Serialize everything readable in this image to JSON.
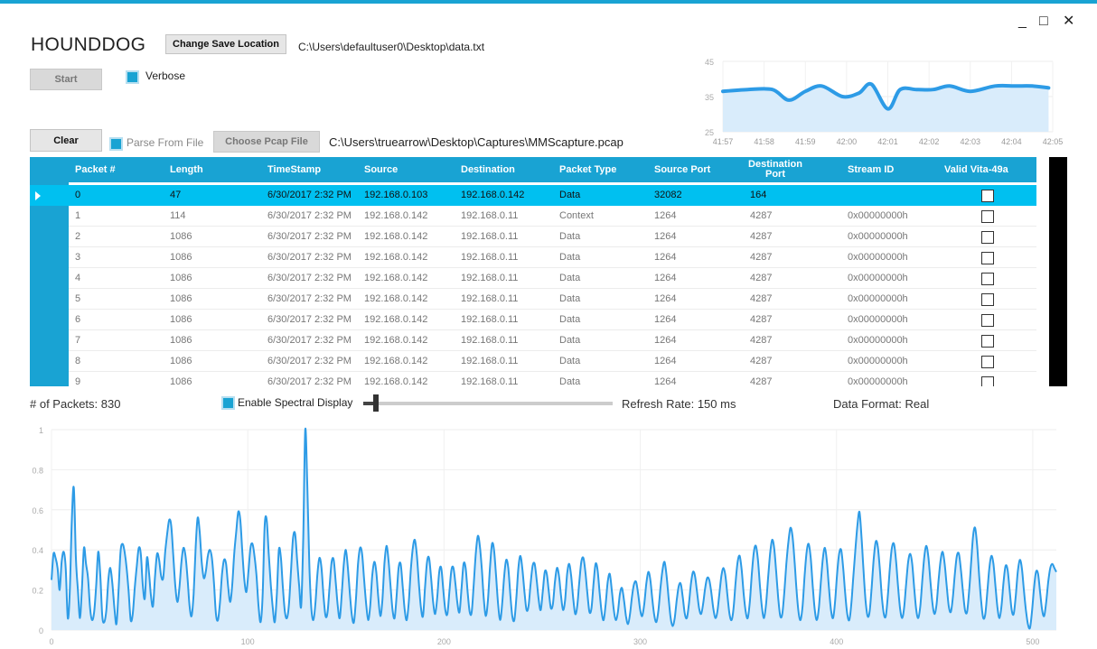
{
  "window": {
    "minimize_glyph": "_",
    "maximize_glyph": "□",
    "close_glyph": "✕"
  },
  "app": {
    "title": "HOUNDDOG"
  },
  "toolbar": {
    "change_save_location_label": "Change Save Location",
    "save_path": "C:\\Users\\defaultuser0\\Desktop\\data.txt",
    "start_label": "Start",
    "verbose_label": "Verbose",
    "clear_label": "Clear",
    "parse_from_file_label": "Parse From File",
    "choose_pcap_label": "Choose Pcap File",
    "pcap_path": "C:\\Users\\truearrow\\Desktop\\Captures\\MMScapture.pcap"
  },
  "table": {
    "columns": [
      "Packet #",
      "Length",
      "TimeStamp",
      "Source",
      "Destination",
      "Packet Type",
      "Source Port",
      "Destination Port",
      "Stream ID",
      "Valid Vita-49a"
    ],
    "rows": [
      [
        "0",
        "47",
        "6/30/2017 2:32 PM",
        "192.168.0.103",
        "192.168.0.142",
        "Data",
        "32082",
        "164",
        ""
      ],
      [
        "1",
        "114",
        "6/30/2017 2:32 PM",
        "192.168.0.142",
        "192.168.0.11",
        "Context",
        "1264",
        "4287",
        "0x00000000h"
      ],
      [
        "2",
        "1086",
        "6/30/2017 2:32 PM",
        "192.168.0.142",
        "192.168.0.11",
        "Data",
        "1264",
        "4287",
        "0x00000000h"
      ],
      [
        "3",
        "1086",
        "6/30/2017 2:32 PM",
        "192.168.0.142",
        "192.168.0.11",
        "Data",
        "1264",
        "4287",
        "0x00000000h"
      ],
      [
        "4",
        "1086",
        "6/30/2017 2:32 PM",
        "192.168.0.142",
        "192.168.0.11",
        "Data",
        "1264",
        "4287",
        "0x00000000h"
      ],
      [
        "5",
        "1086",
        "6/30/2017 2:32 PM",
        "192.168.0.142",
        "192.168.0.11",
        "Data",
        "1264",
        "4287",
        "0x00000000h"
      ],
      [
        "6",
        "1086",
        "6/30/2017 2:32 PM",
        "192.168.0.142",
        "192.168.0.11",
        "Data",
        "1264",
        "4287",
        "0x00000000h"
      ],
      [
        "7",
        "1086",
        "6/30/2017 2:32 PM",
        "192.168.0.142",
        "192.168.0.11",
        "Data",
        "1264",
        "4287",
        "0x00000000h"
      ],
      [
        "8",
        "1086",
        "6/30/2017 2:32 PM",
        "192.168.0.142",
        "192.168.0.11",
        "Data",
        "1264",
        "4287",
        "0x00000000h"
      ],
      [
        "9",
        "1086",
        "6/30/2017 2:32 PM",
        "192.168.0.142",
        "192.168.0.11",
        "Data",
        "1264",
        "4287",
        "0x00000000h"
      ]
    ],
    "selected_row": 0
  },
  "status": {
    "packet_count_label": "# of Packets: 830",
    "spectral_label": "Enable Spectral Display",
    "refresh_label": "Refresh Rate: 150 ms",
    "format_label": "Data Format: Real",
    "slider_value_fraction": 0.05
  },
  "colors": {
    "accent": "#19a3d3",
    "selected_row": "#00c0f0",
    "line": "#2d9be6",
    "area": "#d9ecfb"
  },
  "chart_data": [
    {
      "type": "area",
      "x_labels": [
        "41:57",
        "41:58",
        "41:59",
        "42:00",
        "42:01",
        "42:02",
        "42:03",
        "42:04",
        "42:05"
      ],
      "x": [
        0,
        0.6,
        1.2,
        1.6,
        2.0,
        2.4,
        2.9,
        3.3,
        3.6,
        4.0,
        4.3,
        4.7,
        5.1,
        5.5,
        6.0,
        6.6,
        7.1,
        7.5,
        7.9
      ],
      "values": [
        36.5,
        37,
        37,
        34,
        36.5,
        38,
        35,
        36,
        38.5,
        31.5,
        37,
        37,
        37,
        38,
        36.5,
        38,
        38,
        38,
        37.5
      ],
      "ylim": [
        25,
        45
      ],
      "y_ticks": [
        "25",
        "35",
        "45"
      ],
      "grid": true
    },
    {
      "type": "area",
      "xlim": [
        0,
        512
      ],
      "ylim": [
        0,
        1
      ],
      "x_ticks": [
        "0",
        "100",
        "200",
        "300",
        "400",
        "500"
      ],
      "y_ticks": [
        "0",
        "0.2",
        "0.4",
        "0.6",
        "0.8",
        "1"
      ],
      "grid": true,
      "values": [
        0.25,
        0.38,
        0.36,
        0.31,
        0.2,
        0.34,
        0.39,
        0.31,
        0.06,
        0.19,
        0.55,
        0.71,
        0.36,
        0.2,
        0.06,
        0.21,
        0.41,
        0.33,
        0.26,
        0.11,
        0.05,
        0.09,
        0.22,
        0.39,
        0.28,
        0.07,
        0.04,
        0.1,
        0.25,
        0.31,
        0.23,
        0.11,
        0.03,
        0.19,
        0.39,
        0.43,
        0.39,
        0.31,
        0.19,
        0.05,
        0.08,
        0.21,
        0.32,
        0.41,
        0.38,
        0.22,
        0.16,
        0.36,
        0.29,
        0.17,
        0.12,
        0.27,
        0.38,
        0.35,
        0.27,
        0.26,
        0.39,
        0.48,
        0.55,
        0.52,
        0.37,
        0.22,
        0.14,
        0.21,
        0.34,
        0.41,
        0.37,
        0.26,
        0.12,
        0.07,
        0.18,
        0.41,
        0.56,
        0.49,
        0.34,
        0.26,
        0.29,
        0.37,
        0.4,
        0.36,
        0.24,
        0.08,
        0.05,
        0.14,
        0.28,
        0.35,
        0.33,
        0.22,
        0.14,
        0.22,
        0.38,
        0.49,
        0.59,
        0.55,
        0.39,
        0.25,
        0.19,
        0.29,
        0.41,
        0.43,
        0.37,
        0.27,
        0.12,
        0.04,
        0.17,
        0.52,
        0.55,
        0.38,
        0.23,
        0.11,
        0.04,
        0.18,
        0.4,
        0.36,
        0.21,
        0.09,
        0.06,
        0.13,
        0.3,
        0.46,
        0.48,
        0.35,
        0.22,
        0.12,
        0.46,
        1.0,
        0.72,
        0.33,
        0.11,
        0.05,
        0.13,
        0.28,
        0.36,
        0.31,
        0.17,
        0.07,
        0.09,
        0.22,
        0.34,
        0.35,
        0.24,
        0.12,
        0.06,
        0.18,
        0.33,
        0.4,
        0.31,
        0.18,
        0.07,
        0.04,
        0.16,
        0.33,
        0.41,
        0.38,
        0.25,
        0.13,
        0.05,
        0.12,
        0.27,
        0.34,
        0.29,
        0.16,
        0.07,
        0.15,
        0.33,
        0.42,
        0.35,
        0.22,
        0.1,
        0.06,
        0.17,
        0.31,
        0.33,
        0.22,
        0.1,
        0.05,
        0.14,
        0.3,
        0.41,
        0.45,
        0.37,
        0.23,
        0.11,
        0.07,
        0.21,
        0.34,
        0.36,
        0.26,
        0.14,
        0.08,
        0.16,
        0.29,
        0.31,
        0.2,
        0.1,
        0.08,
        0.19,
        0.3,
        0.31,
        0.23,
        0.13,
        0.09,
        0.21,
        0.33,
        0.31,
        0.19,
        0.09,
        0.09,
        0.23,
        0.38,
        0.47,
        0.42,
        0.3,
        0.15,
        0.07,
        0.15,
        0.31,
        0.43,
        0.4,
        0.27,
        0.13,
        0.05,
        0.13,
        0.27,
        0.35,
        0.31,
        0.18,
        0.07,
        0.05,
        0.16,
        0.31,
        0.37,
        0.3,
        0.19,
        0.1,
        0.12,
        0.23,
        0.32,
        0.33,
        0.25,
        0.15,
        0.1,
        0.19,
        0.29,
        0.28,
        0.19,
        0.11,
        0.13,
        0.24,
        0.31,
        0.27,
        0.17,
        0.1,
        0.15,
        0.28,
        0.33,
        0.27,
        0.16,
        0.08,
        0.12,
        0.24,
        0.34,
        0.36,
        0.29,
        0.18,
        0.09,
        0.11,
        0.23,
        0.33,
        0.3,
        0.19,
        0.09,
        0.05,
        0.13,
        0.24,
        0.28,
        0.2,
        0.1,
        0.05,
        0.09,
        0.18,
        0.21,
        0.15,
        0.07,
        0.03,
        0.08,
        0.17,
        0.23,
        0.24,
        0.18,
        0.1,
        0.07,
        0.13,
        0.23,
        0.29,
        0.25,
        0.15,
        0.07,
        0.04,
        0.1,
        0.21,
        0.3,
        0.34,
        0.27,
        0.16,
        0.06,
        0.02,
        0.06,
        0.15,
        0.22,
        0.23,
        0.16,
        0.08,
        0.06,
        0.13,
        0.23,
        0.29,
        0.27,
        0.19,
        0.11,
        0.08,
        0.13,
        0.21,
        0.26,
        0.25,
        0.19,
        0.11,
        0.06,
        0.09,
        0.18,
        0.27,
        0.31,
        0.27,
        0.17,
        0.08,
        0.05,
        0.11,
        0.24,
        0.34,
        0.37,
        0.3,
        0.18,
        0.09,
        0.06,
        0.14,
        0.28,
        0.39,
        0.42,
        0.35,
        0.22,
        0.11,
        0.06,
        0.13,
        0.26,
        0.38,
        0.45,
        0.41,
        0.29,
        0.16,
        0.07,
        0.08,
        0.19,
        0.33,
        0.44,
        0.51,
        0.47,
        0.35,
        0.2,
        0.09,
        0.05,
        0.12,
        0.27,
        0.39,
        0.43,
        0.36,
        0.22,
        0.1,
        0.05,
        0.11,
        0.24,
        0.36,
        0.41,
        0.34,
        0.21,
        0.1,
        0.06,
        0.14,
        0.28,
        0.38,
        0.4,
        0.31,
        0.18,
        0.08,
        0.05,
        0.13,
        0.27,
        0.4,
        0.52,
        0.59,
        0.47,
        0.3,
        0.15,
        0.07,
        0.09,
        0.21,
        0.35,
        0.44,
        0.42,
        0.31,
        0.17,
        0.08,
        0.07,
        0.17,
        0.31,
        0.41,
        0.43,
        0.35,
        0.22,
        0.11,
        0.06,
        0.11,
        0.23,
        0.34,
        0.38,
        0.33,
        0.21,
        0.1,
        0.06,
        0.12,
        0.25,
        0.37,
        0.42,
        0.36,
        0.24,
        0.13,
        0.08,
        0.13,
        0.25,
        0.35,
        0.39,
        0.33,
        0.22,
        0.12,
        0.09,
        0.16,
        0.28,
        0.37,
        0.38,
        0.3,
        0.19,
        0.1,
        0.09,
        0.19,
        0.33,
        0.47,
        0.51,
        0.42,
        0.27,
        0.14,
        0.06,
        0.08,
        0.19,
        0.31,
        0.37,
        0.33,
        0.22,
        0.11,
        0.06,
        0.12,
        0.24,
        0.32,
        0.3,
        0.2,
        0.1,
        0.08,
        0.17,
        0.29,
        0.35,
        0.31,
        0.2,
        0.1,
        0.03,
        0.01,
        0.09,
        0.21,
        0.29,
        0.28,
        0.19,
        0.1,
        0.07,
        0.14,
        0.24,
        0.31,
        0.33,
        0.31,
        0.29
      ]
    }
  ]
}
